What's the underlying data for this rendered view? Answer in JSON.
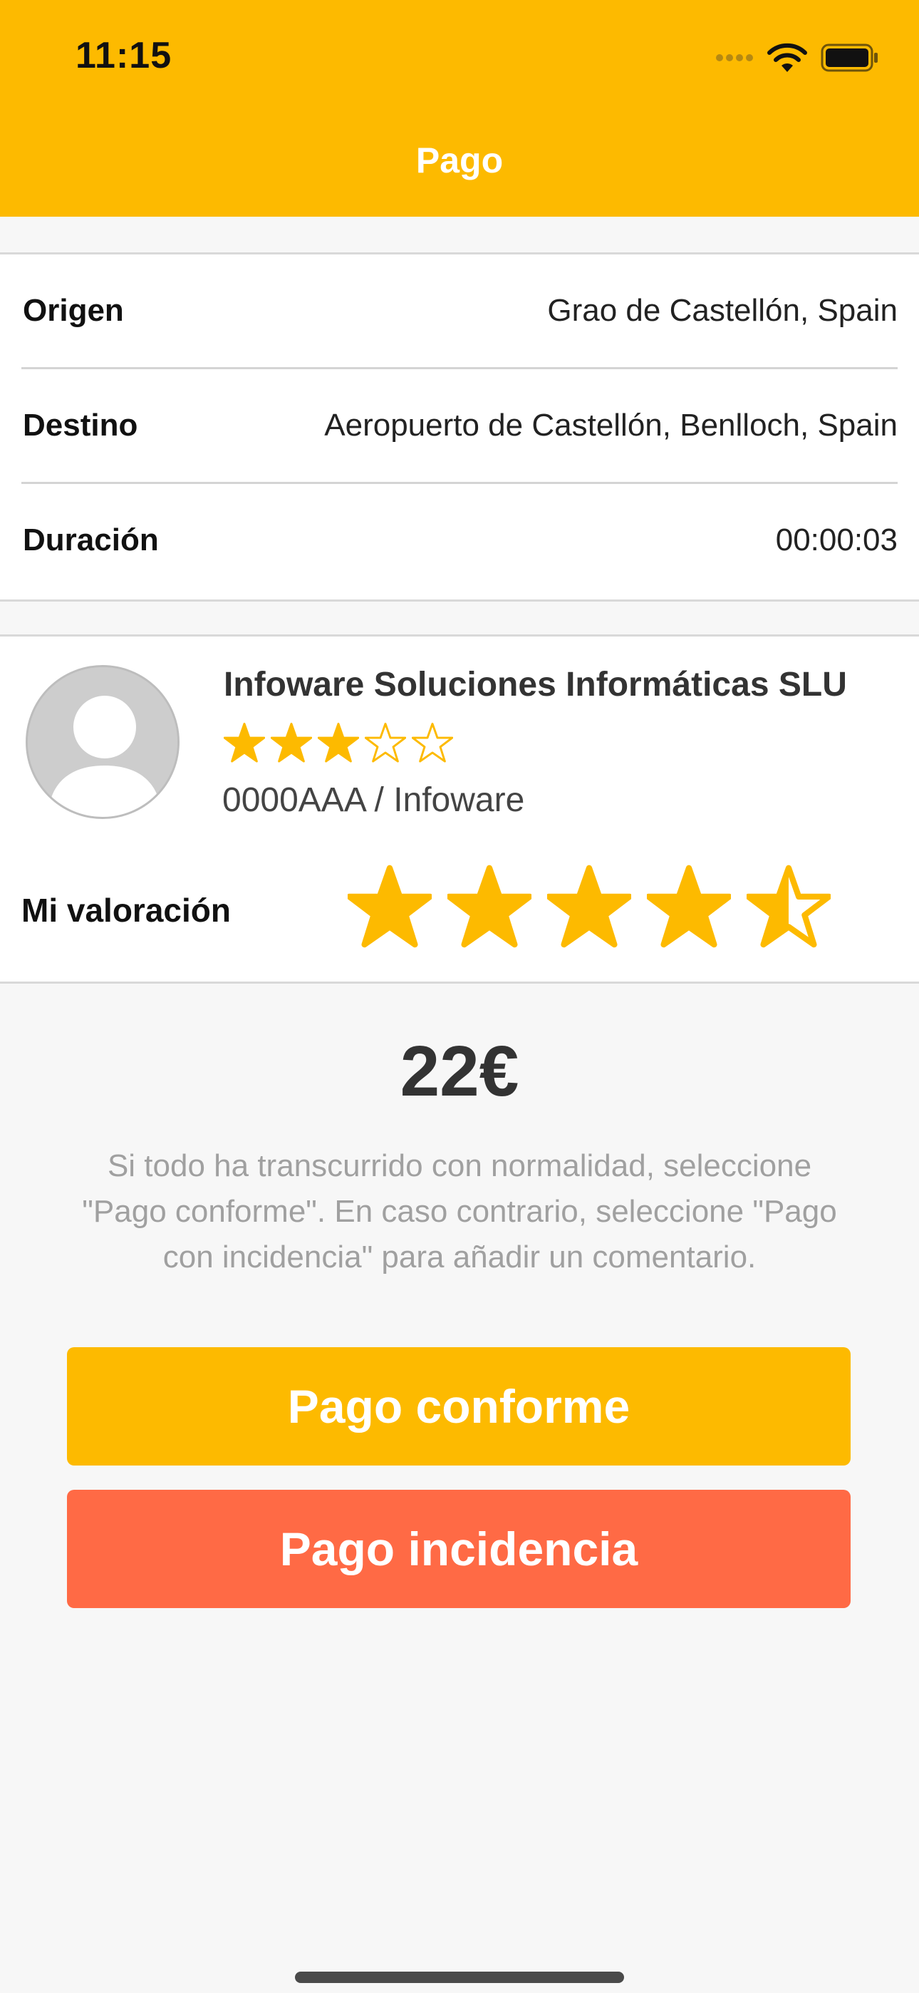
{
  "status_bar": {
    "time": "11:15",
    "icons": [
      "signal-dots-icon",
      "wifi-icon",
      "battery-icon"
    ]
  },
  "nav": {
    "title": "Pago"
  },
  "trip": {
    "rows": [
      {
        "label": "Origen",
        "value": "Grao de Castellón, Spain"
      },
      {
        "label": "Destino",
        "value": "Aeropuerto de Castellón, Benlloch, Spain"
      },
      {
        "label": "Duración",
        "value": "00:00:03"
      }
    ]
  },
  "driver": {
    "name": "Infoware Soluciones Informáticas SLU",
    "rating": 3,
    "rating_max": 5,
    "plate": "0000AAA / Infoware"
  },
  "my_rating": {
    "label": "Mi valoración",
    "value": 4.5,
    "max": 5
  },
  "payment": {
    "price": "22€",
    "note": "Si todo ha transcurrido con normalidad, seleccione \"Pago conforme\". En caso contrario, seleccione \"Pago con incidencia\" para añadir un comentario.",
    "ok_label": "Pago conforme",
    "incident_label": "Pago incidencia"
  },
  "colors": {
    "accent": "#fdba00",
    "incident": "#ff6a45",
    "background": "#f7f7f7"
  }
}
